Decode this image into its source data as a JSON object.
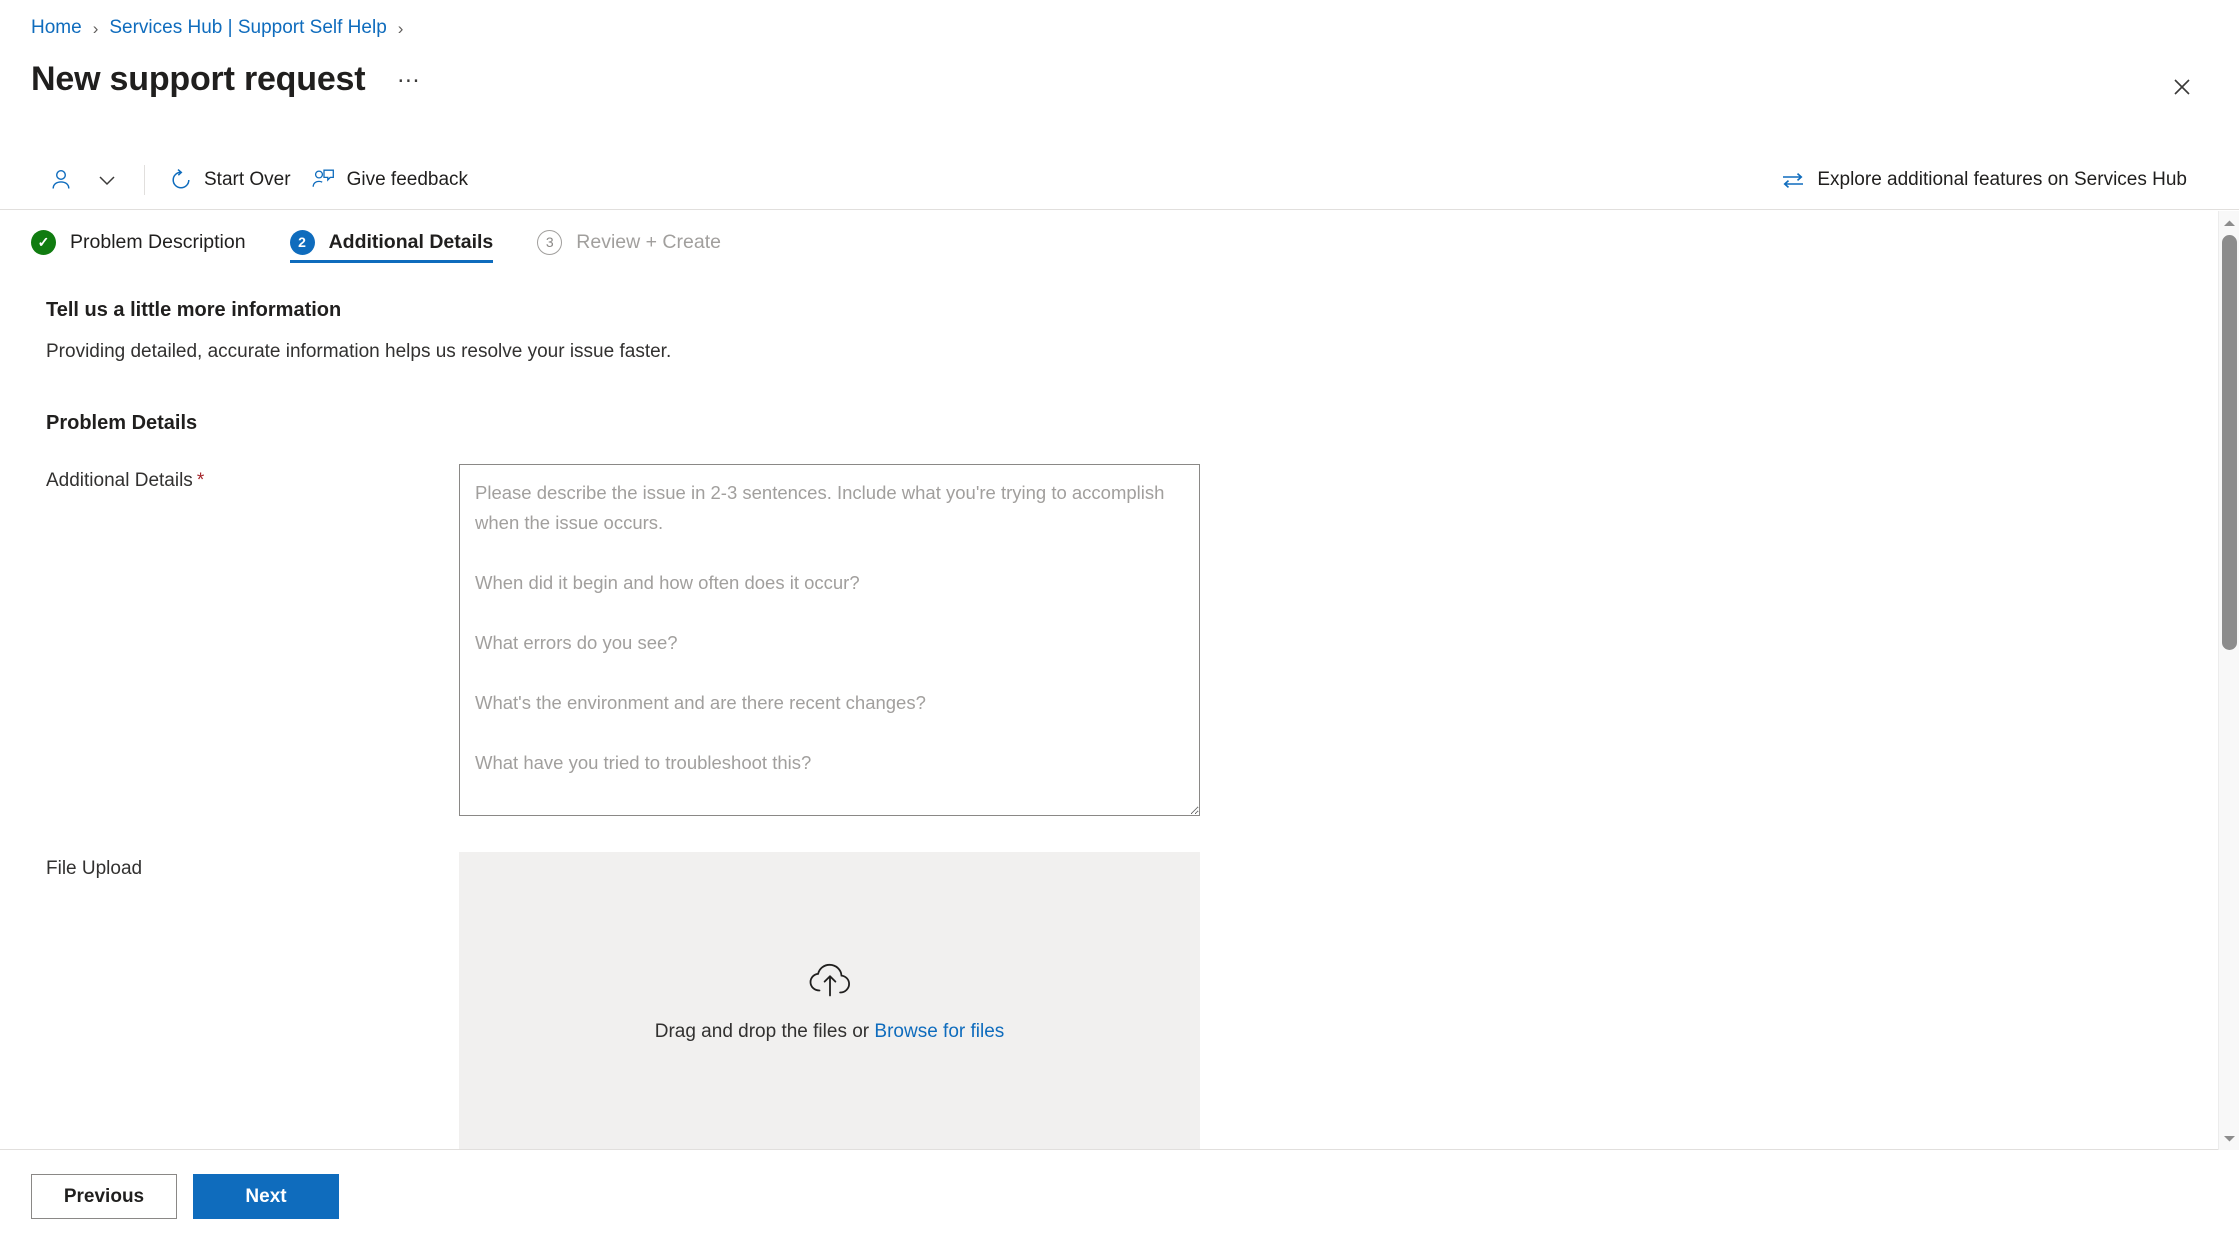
{
  "breadcrumb": {
    "items": [
      {
        "label": "Home"
      },
      {
        "label": "Services Hub | Support Self Help"
      }
    ],
    "separator": "›"
  },
  "header": {
    "title": "New support request",
    "more_label": "…",
    "close_label": "Close"
  },
  "commandbar": {
    "account_icon": "person-icon",
    "chevron_icon": "chevron-down-icon",
    "items": [
      {
        "label": "Start Over",
        "icon": "refresh-icon"
      },
      {
        "label": "Give feedback",
        "icon": "feedback-person-icon"
      }
    ],
    "right_link": {
      "label": "Explore additional features on Services Hub",
      "icon": "swap-arrows-icon"
    }
  },
  "tabs": [
    {
      "badge": "✓",
      "label": "Problem Description",
      "state": "done"
    },
    {
      "badge": "2",
      "label": "Additional Details",
      "state": "current"
    },
    {
      "badge": "3",
      "label": "Review + Create",
      "state": "todo"
    }
  ],
  "main": {
    "section_title": "Tell us a little more information",
    "section_subtitle": "Providing detailed, accurate information helps us resolve your issue faster.",
    "group_title": "Problem Details",
    "fields": {
      "additional_details": {
        "label": "Additional Details",
        "required_marker": "*",
        "value": "",
        "placeholder": "Please describe the issue in 2-3 sentences. Include what you're trying to accomplish when the issue occurs.\n\nWhen did it begin and how often does it occur?\n\nWhat errors do you see?\n\nWhat's the environment and are there recent changes?\n\nWhat have you tried to troubleshoot this?"
      },
      "file_upload": {
        "label": "File Upload",
        "drop_text": "Drag and drop the files or",
        "browse_link": "Browse for files",
        "icon": "cloud-upload-icon"
      }
    }
  },
  "footer": {
    "previous_label": "Previous",
    "next_label": "Next"
  },
  "colors": {
    "accent": "#0f6cbd",
    "success": "#107c10",
    "required": "#a4262c",
    "disabled_text": "#a19f9d",
    "upload_bg": "#f1f0ef"
  }
}
